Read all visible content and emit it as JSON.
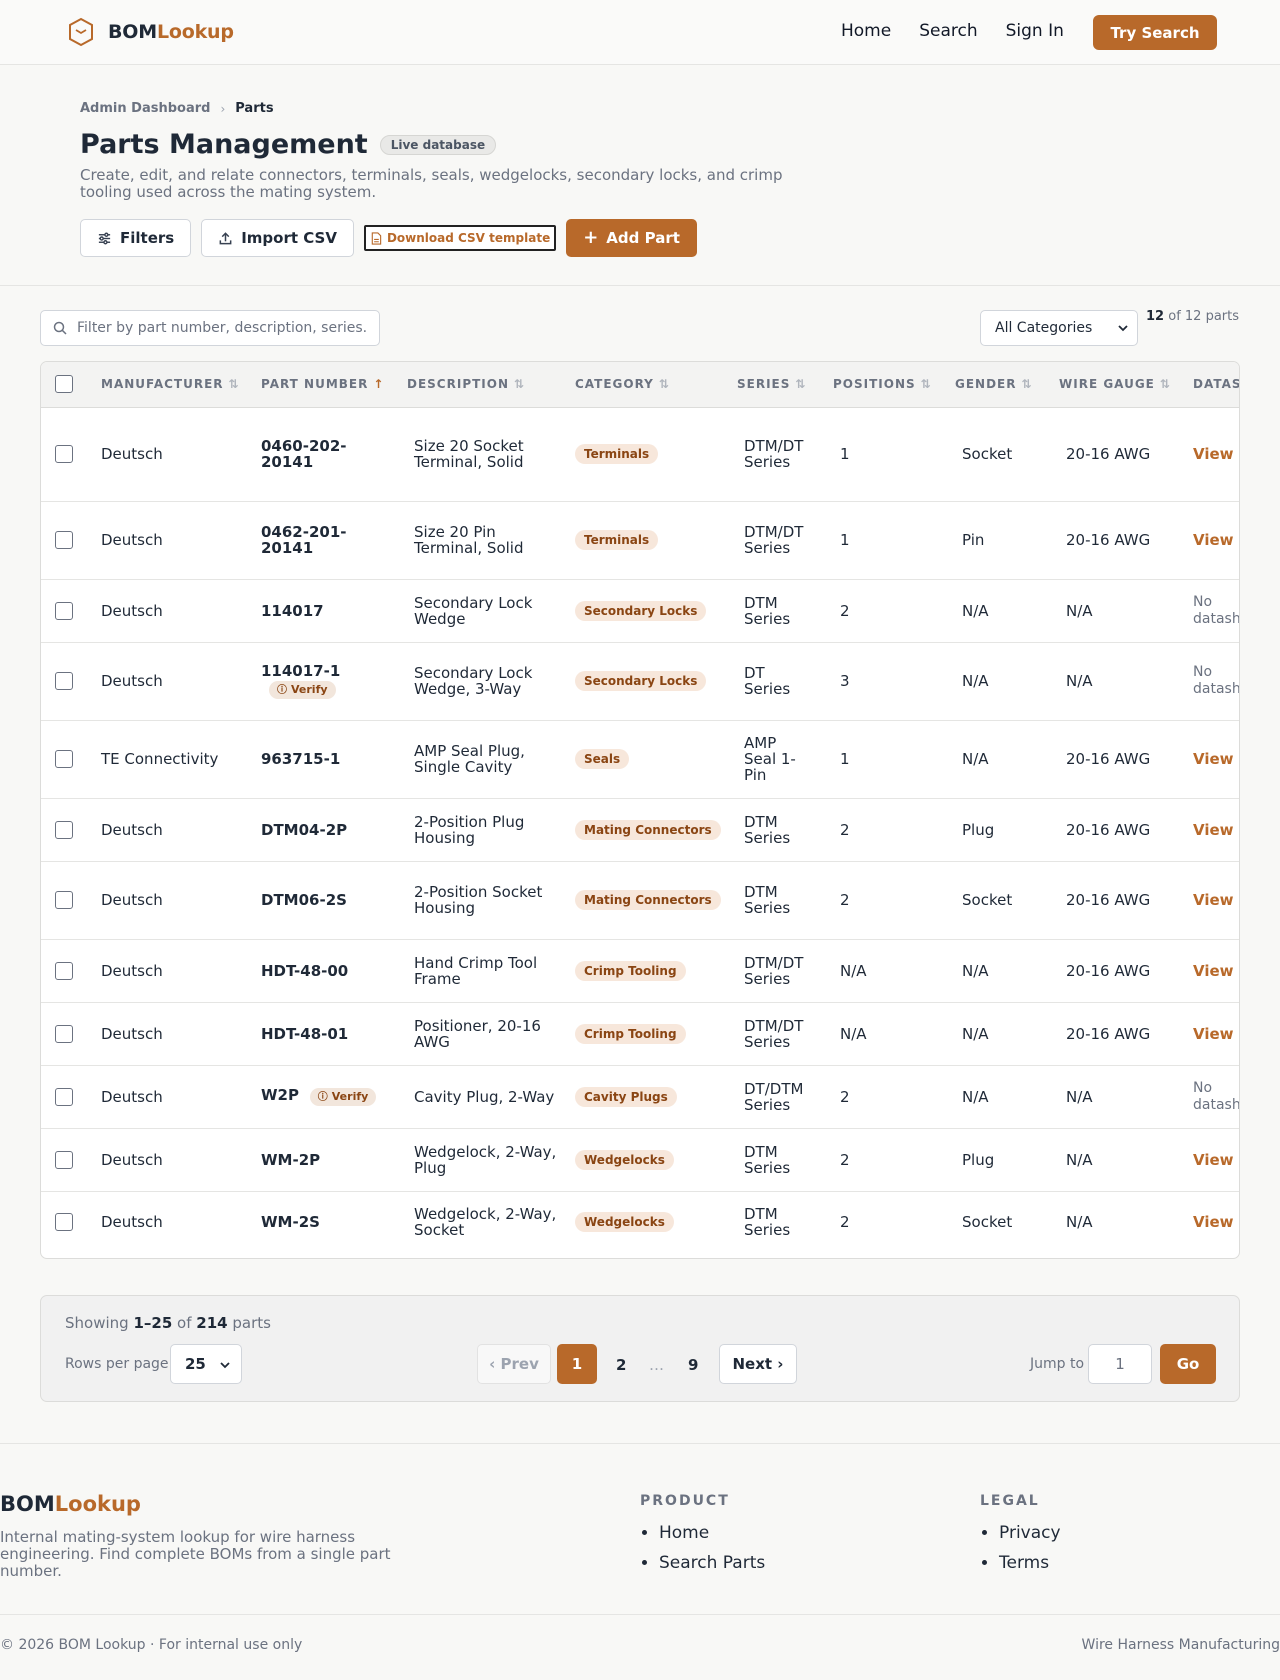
{
  "nav": {
    "brand_a": "BOM",
    "brand_b": "Lookup",
    "links": [
      "Home",
      "Search",
      "Sign In"
    ],
    "cta": "Try Search"
  },
  "breadcrumb": {
    "parent": "Admin Dashboard",
    "current": "Parts"
  },
  "page": {
    "title": "Parts Management",
    "badge": "Live database",
    "subtitle": "Create, edit, and relate connectors, terminals, seals, wedgelocks, secondary locks, and crimp tooling used across the mating system."
  },
  "actions": {
    "filters": "Filters",
    "import": "Import CSV",
    "template": "Download CSV template",
    "add": "Add Part"
  },
  "toolbar": {
    "search_placeholder": "Filter by part number, description, series...",
    "category": "All Categories",
    "count_shown": "12",
    "count_rest": "of 12 parts"
  },
  "table": {
    "headers": [
      "MANUFACTURER",
      "PART NUMBER",
      "DESCRIPTION",
      "CATEGORY",
      "SERIES",
      "POSITIONS",
      "GENDER",
      "WIRE GAUGE",
      "DATASHEET"
    ],
    "verify_label": "Verify",
    "view_label": "View",
    "no_datasheet": "No datasheet",
    "rows": [
      {
        "manufacturer": "Deutsch",
        "part": "0460-202-20141",
        "description": "Size 20 Socket Terminal, Solid",
        "category": "Terminals",
        "series": "DTM/DT Series",
        "positions": "1",
        "gender": "Socket",
        "gauge": "20-16 AWG",
        "datasheet": true,
        "verify": false
      },
      {
        "manufacturer": "Deutsch",
        "part": "0462-201-20141",
        "description": "Size 20 Pin Terminal, Solid",
        "category": "Terminals",
        "series": "DTM/DT Series",
        "positions": "1",
        "gender": "Pin",
        "gauge": "20-16 AWG",
        "datasheet": true,
        "verify": false
      },
      {
        "manufacturer": "Deutsch",
        "part": "114017",
        "description": "Secondary Lock Wedge",
        "category": "Secondary Locks",
        "series": "DTM Series",
        "positions": "2",
        "gender": "N/A",
        "gauge": "N/A",
        "datasheet": false,
        "verify": false
      },
      {
        "manufacturer": "Deutsch",
        "part": "114017-1",
        "description": "Secondary Lock Wedge, 3-Way",
        "category": "Secondary Locks",
        "series": "DT Series",
        "positions": "3",
        "gender": "N/A",
        "gauge": "N/A",
        "datasheet": false,
        "verify": true
      },
      {
        "manufacturer": "TE Connectivity",
        "part": "963715-1",
        "description": "AMP Seal Plug, Single Cavity",
        "category": "Seals",
        "series": "AMP Seal 1-Pin",
        "positions": "1",
        "gender": "N/A",
        "gauge": "20-16 AWG",
        "datasheet": true,
        "verify": false
      },
      {
        "manufacturer": "Deutsch",
        "part": "DTM04-2P",
        "description": "2-Position Plug Housing",
        "category": "Mating Connectors",
        "series": "DTM Series",
        "positions": "2",
        "gender": "Plug",
        "gauge": "20-16 AWG",
        "datasheet": true,
        "verify": false
      },
      {
        "manufacturer": "Deutsch",
        "part": "DTM06-2S",
        "description": "2-Position Socket Housing",
        "category": "Mating Connectors",
        "series": "DTM Series",
        "positions": "2",
        "gender": "Socket",
        "gauge": "20-16 AWG",
        "datasheet": true,
        "verify": false
      },
      {
        "manufacturer": "Deutsch",
        "part": "HDT-48-00",
        "description": "Hand Crimp Tool Frame",
        "category": "Crimp Tooling",
        "series": "DTM/DT Series",
        "positions": "N/A",
        "gender": "N/A",
        "gauge": "20-16 AWG",
        "datasheet": true,
        "verify": false
      },
      {
        "manufacturer": "Deutsch",
        "part": "HDT-48-01",
        "description": "Positioner, 20-16 AWG",
        "category": "Crimp Tooling",
        "series": "DTM/DT Series",
        "positions": "N/A",
        "gender": "N/A",
        "gauge": "20-16 AWG",
        "datasheet": true,
        "verify": false
      },
      {
        "manufacturer": "Deutsch",
        "part": "W2P",
        "description": "Cavity Plug, 2-Way",
        "category": "Cavity Plugs",
        "series": "DT/DTM Series",
        "positions": "2",
        "gender": "N/A",
        "gauge": "N/A",
        "datasheet": false,
        "verify": true
      },
      {
        "manufacturer": "Deutsch",
        "part": "WM-2P",
        "description": "Wedgelock, 2-Way, Plug",
        "category": "Wedgelocks",
        "series": "DTM Series",
        "positions": "2",
        "gender": "Plug",
        "gauge": "N/A",
        "datasheet": true,
        "verify": false
      },
      {
        "manufacturer": "Deutsch",
        "part": "WM-2S",
        "description": "Wedgelock, 2-Way, Socket",
        "category": "Wedgelocks",
        "series": "DTM Series",
        "positions": "2",
        "gender": "Socket",
        "gauge": "N/A",
        "datasheet": true,
        "verify": false
      }
    ]
  },
  "pagination": {
    "showing_prefix": "Showing",
    "range": "1–25",
    "of": "of",
    "total": "214",
    "unit": "parts",
    "rows_label": "Rows per page",
    "rows_value": "25",
    "prev": "‹ Prev",
    "pages": [
      "1",
      "2",
      "…",
      "9"
    ],
    "current_page": "1",
    "next": "Next ›",
    "jump_label": "Jump to",
    "jump_value": "1",
    "go": "Go"
  },
  "footer": {
    "brand_a": "BOM",
    "brand_b": "Lookup",
    "description": "Internal mating-system lookup for wire harness engineering. Find complete BOMs from a single part number.",
    "product_heading": "PRODUCT",
    "product_links": [
      "Home",
      "Search Parts"
    ],
    "legal_heading": "LEGAL",
    "legal_links": [
      "Privacy",
      "Terms"
    ],
    "copyright": "© 2026 BOM Lookup · For internal use only",
    "right_text": "Wire Harness Manufacturing"
  },
  "colors": {
    "accent": "#b8692a",
    "badge_bg": "#f7e7db",
    "badge_text": "#8a4513"
  }
}
